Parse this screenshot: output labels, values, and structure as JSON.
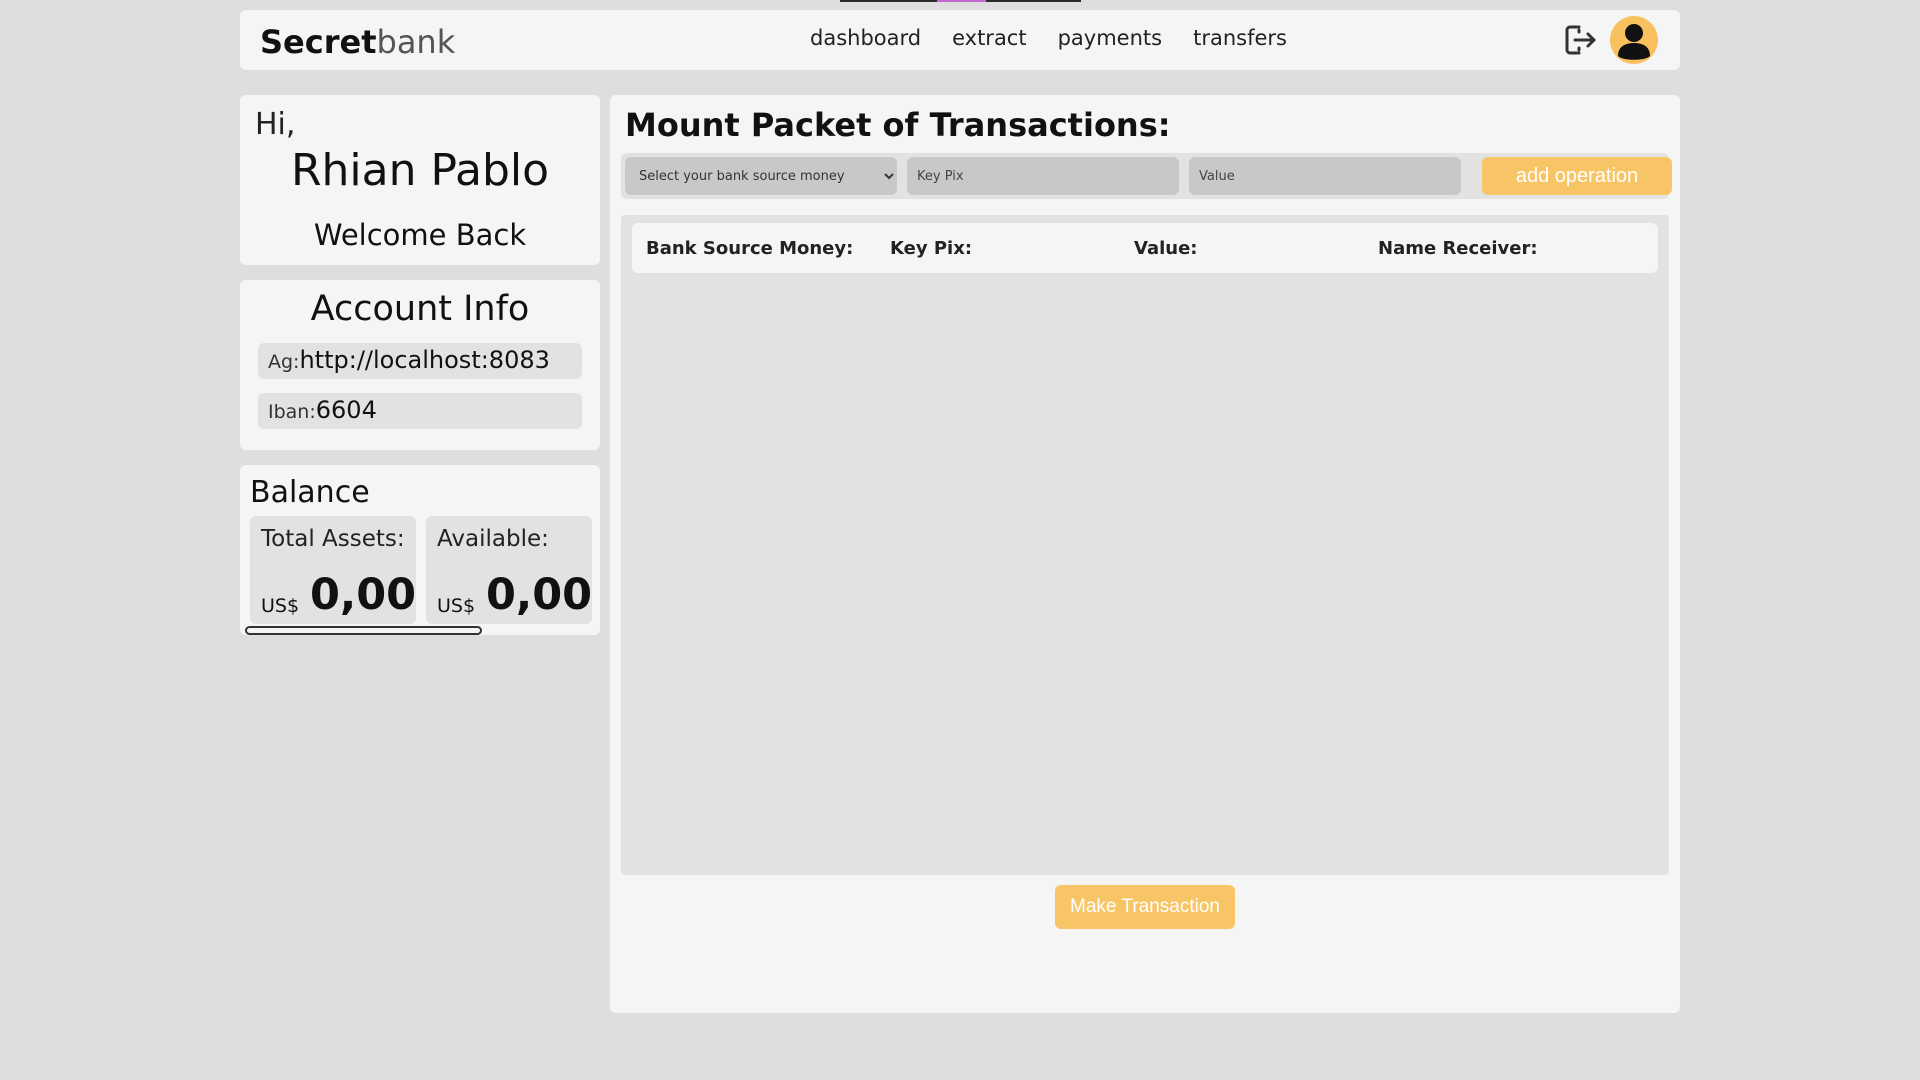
{
  "brand": {
    "bold": "Secret",
    "light": "bank"
  },
  "nav": {
    "items": [
      "dashboard",
      "extract",
      "payments",
      "transfers"
    ]
  },
  "icons": {
    "logout": "logout-icon",
    "avatar": "user-avatar-icon"
  },
  "greeting": {
    "hi": "Hi,",
    "name": "Rhian Pablo",
    "welcome": "Welcome Back"
  },
  "account": {
    "title": "Account Info",
    "ag_label": "Ag:",
    "ag_value": "http://localhost:8083",
    "iban_label": "Iban:",
    "iban_value": "6604"
  },
  "balance": {
    "title": "Balance",
    "total_label": "Total Assets:",
    "total_currency": "US$",
    "total_amount": "0,00",
    "available_label": "Available:",
    "available_currency": "US$",
    "available_amount": "0,00"
  },
  "packet": {
    "title": "Mount Packet of Transactions:",
    "select_placeholder": "Select your bank source money",
    "keypix_placeholder": "Key Pix",
    "value_placeholder": "Value",
    "add_button": "add operation",
    "columns": [
      "Bank Source Money:",
      "Key Pix:",
      "Value:",
      "Name Receiver:"
    ],
    "make_button": "Make Transaction"
  },
  "colors": {
    "accent": "#f8c566",
    "panel": "#f5f5f5",
    "background": "#dedede"
  }
}
